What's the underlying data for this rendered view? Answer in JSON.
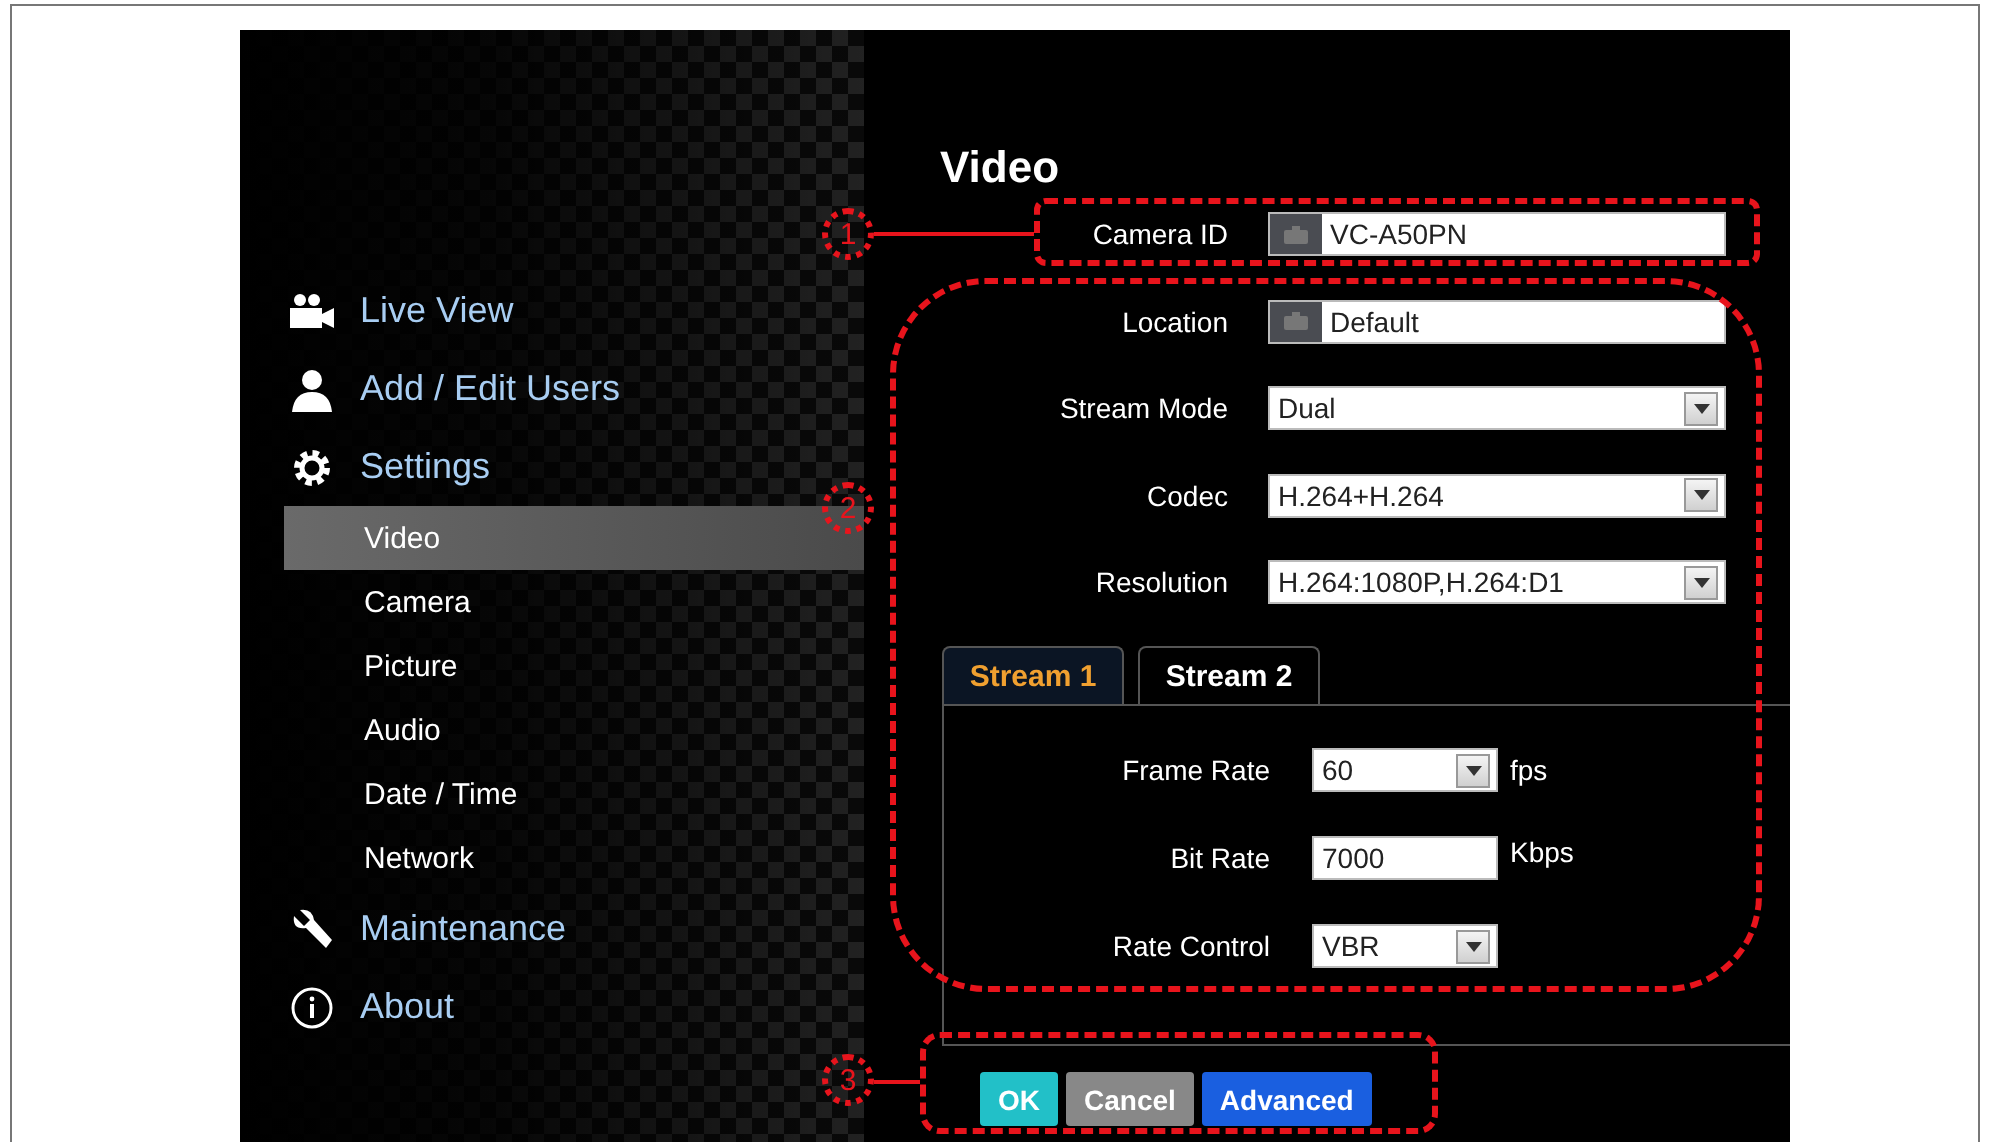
{
  "sidebar": {
    "items": [
      {
        "label": "Live View",
        "kind": "main",
        "selected": false
      },
      {
        "label": "Add / Edit Users",
        "kind": "main",
        "selected": false
      },
      {
        "label": "Settings",
        "kind": "main",
        "selected": false
      },
      {
        "label": "Video",
        "kind": "sub",
        "selected": true
      },
      {
        "label": "Camera",
        "kind": "sub",
        "selected": false
      },
      {
        "label": "Picture",
        "kind": "sub",
        "selected": false
      },
      {
        "label": "Audio",
        "kind": "sub",
        "selected": false
      },
      {
        "label": "Date / Time",
        "kind": "sub",
        "selected": false
      },
      {
        "label": "Network",
        "kind": "sub",
        "selected": false
      },
      {
        "label": "Maintenance",
        "kind": "main",
        "selected": false
      },
      {
        "label": "About",
        "kind": "main",
        "selected": false
      }
    ]
  },
  "page_title": "Video",
  "fields": [
    {
      "label": "Camera ID",
      "kind": "text",
      "value": "VC-A50PN"
    },
    {
      "label": "Location",
      "kind": "text",
      "value": "Default"
    },
    {
      "label": "Stream Mode",
      "kind": "select",
      "value": "Dual"
    },
    {
      "label": "Codec",
      "kind": "select",
      "value": "H.264+H.264"
    },
    {
      "label": "Resolution",
      "kind": "select",
      "value": "H.264:1080P,H.264:D1"
    }
  ],
  "tabs": [
    {
      "label": "Stream 1",
      "selected": true
    },
    {
      "label": "Stream 2",
      "selected": false
    }
  ],
  "stream_fields": [
    {
      "label": "Frame Rate",
      "kind": "select",
      "value": "60",
      "unit": "fps"
    },
    {
      "label": "Bit Rate",
      "kind": "text",
      "value": "7000",
      "unit": "Kbps"
    },
    {
      "label": "Rate Control",
      "kind": "select",
      "value": "VBR"
    }
  ],
  "buttons": [
    {
      "label": "OK",
      "kind": "ok"
    },
    {
      "label": "Cancel",
      "kind": "cancel"
    },
    {
      "label": "Advanced",
      "kind": "advanced"
    }
  ],
  "annotations": [
    {
      "label": "1"
    },
    {
      "label": "2"
    },
    {
      "label": "3"
    }
  ]
}
